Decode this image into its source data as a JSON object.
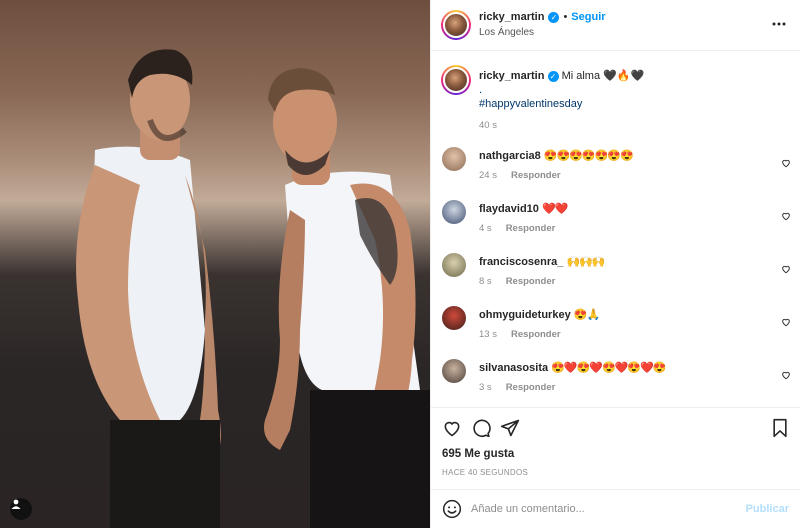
{
  "header": {
    "username": "ricky_martin",
    "follow_label": "Seguir",
    "separator": "•",
    "location": "Los Ángeles"
  },
  "caption": {
    "username": "ricky_martin",
    "text": "Mi alma 🖤🔥🖤",
    "dot": ".",
    "hashtag": "#happyvalentinesday",
    "time": "40 s"
  },
  "comments": [
    {
      "username": "nathgarcia8",
      "text": "😍😍😍😍😍😍😍",
      "time": "24 s",
      "reply": "Responder"
    },
    {
      "username": "flaydavid10",
      "text": "❤️❤️",
      "time": "4 s",
      "reply": "Responder"
    },
    {
      "username": "franciscosenra_",
      "text": "🙌🙌🙌",
      "time": "8 s",
      "reply": "Responder"
    },
    {
      "username": "ohmyguideturkey",
      "text": "😍🙏",
      "time": "13 s",
      "reply": "Responder"
    },
    {
      "username": "silvanasosita",
      "text": "😍❤️😍❤️😍❤️😍❤️😍",
      "time": "3 s",
      "reply": "Responder"
    }
  ],
  "actions": {
    "likes": "695 Me gusta",
    "ago": "HACE 40 SEGUNDOS"
  },
  "composer": {
    "placeholder": "Añade un comentario...",
    "publish_label": "Publicar"
  },
  "icons": [
    "user-tag-icon",
    "verified-icon",
    "more-icon",
    "heart-icon",
    "comment-icon",
    "share-icon",
    "save-icon",
    "emoji-icon"
  ],
  "colors": {
    "accent": "#0095f6",
    "hashtag": "#00376b",
    "muted": "#8e8e8e",
    "publish_disabled": "#b2dffc"
  }
}
